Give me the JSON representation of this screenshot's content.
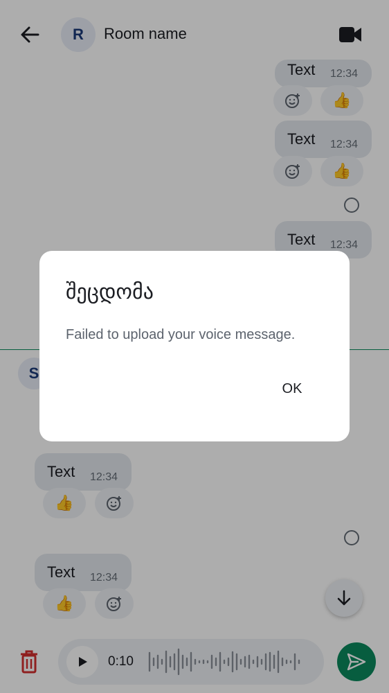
{
  "header": {
    "avatar_initial": "R",
    "room_name": "Room name"
  },
  "messages": [
    {
      "text": "Text",
      "time": "12:34",
      "reactions": [
        "add-reaction",
        "👍"
      ]
    },
    {
      "text": "Text",
      "time": "12:34",
      "reactions": [
        "add-reaction",
        "👍"
      ]
    },
    {
      "text": "Text",
      "time": "12:34"
    },
    {
      "sender_initial": "S"
    },
    {
      "text": "Text",
      "time": "12:34",
      "reactions": [
        "👍",
        "add-reaction"
      ]
    },
    {
      "text": "Text",
      "time": "12:34",
      "reactions": [
        "👍",
        "add-reaction"
      ]
    }
  ],
  "composer": {
    "duration": "0:10"
  },
  "dialog": {
    "title": "შეცდომა",
    "message": "Failed to upload your voice message.",
    "ok_label": "OK"
  },
  "colors": {
    "accent": "#0b8a5e",
    "delete": "#d32f2f",
    "bubble": "#e4e8ee"
  },
  "icons": [
    "back-arrow-icon",
    "video-call-icon",
    "add-reaction-icon",
    "thumbs-up-emoji",
    "radio-unchecked-icon",
    "arrow-down-icon",
    "trash-icon",
    "play-icon",
    "waveform",
    "send-icon"
  ]
}
